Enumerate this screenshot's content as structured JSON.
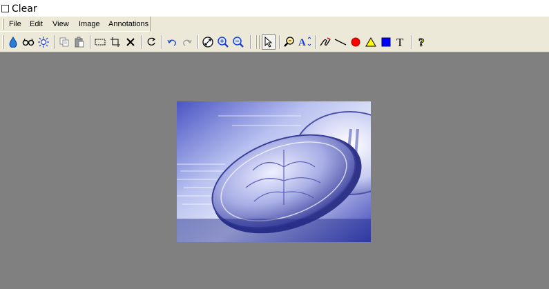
{
  "top": {
    "clear_label": "Clear"
  },
  "menu": {
    "items": [
      "File",
      "Edit",
      "View",
      "Image",
      "Annotations"
    ]
  },
  "toolbar": {
    "buttons": [
      "color-drop-icon",
      "glasses-icon",
      "brightness-icon",
      "copy-icon",
      "paste-icon",
      "select-rect-icon",
      "crop-icon",
      "delete-icon",
      "rotate-icon",
      "undo-icon",
      "redo-icon",
      "zoom-fit-icon",
      "zoom-in-icon",
      "zoom-out-icon",
      "pointer-icon",
      "magnify-icon",
      "text-style-icon",
      "freehand-icon",
      "line-icon",
      "ellipse-icon",
      "triangle-icon",
      "rectangle-icon",
      "text-icon",
      "help-icon"
    ],
    "text_tool_glyph": "T",
    "text_style_glyph": "A",
    "help_glyph": "?"
  },
  "colors": {
    "workspace": "#808080",
    "toolbar_bg": "#ece9d8",
    "ellipse_red": "#ff0000",
    "triangle_yellow": "#ffff00",
    "rectangle_blue": "#0000ff"
  }
}
